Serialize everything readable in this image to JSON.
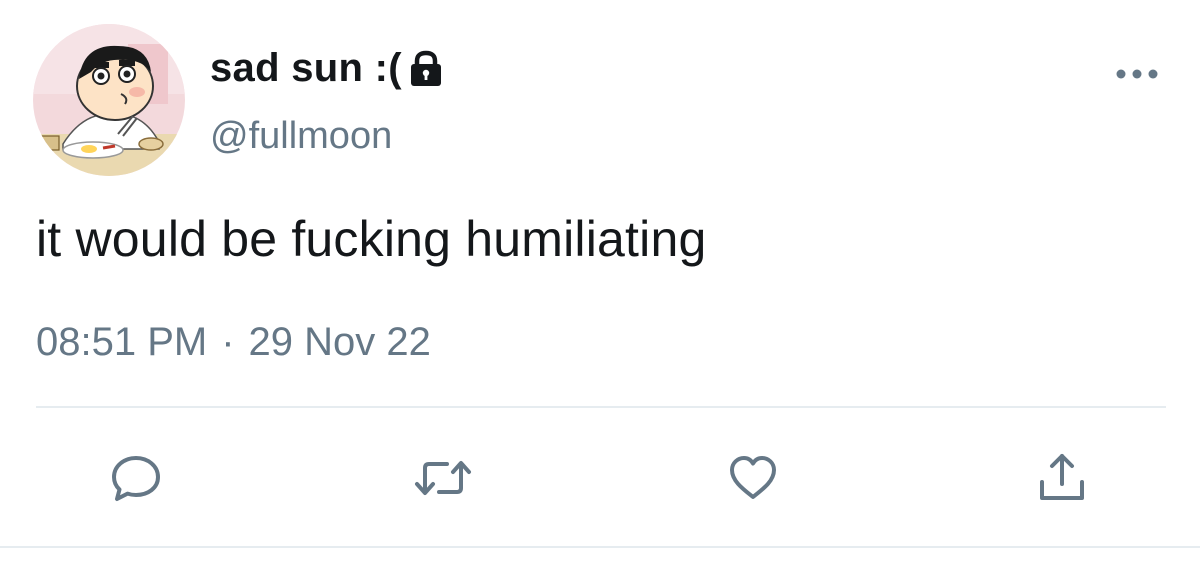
{
  "author": {
    "display_name": "sad sun :(",
    "handle": "@fullmoon",
    "avatar_icon": "cartoon-avatar",
    "protected_icon": "lock-icon"
  },
  "tweet": {
    "text": "it would be fucking humiliating",
    "time": "08:51 PM",
    "separator": "·",
    "date": "29 Nov 22"
  },
  "actions": {
    "reply_icon": "reply-icon",
    "retweet_icon": "retweet-icon",
    "like_icon": "heart-icon",
    "share_icon": "share-icon",
    "more_icon": "more-icon"
  },
  "colors": {
    "primary_text": "#14171a",
    "secondary_text": "#657786",
    "divider": "#e6ecf0"
  }
}
